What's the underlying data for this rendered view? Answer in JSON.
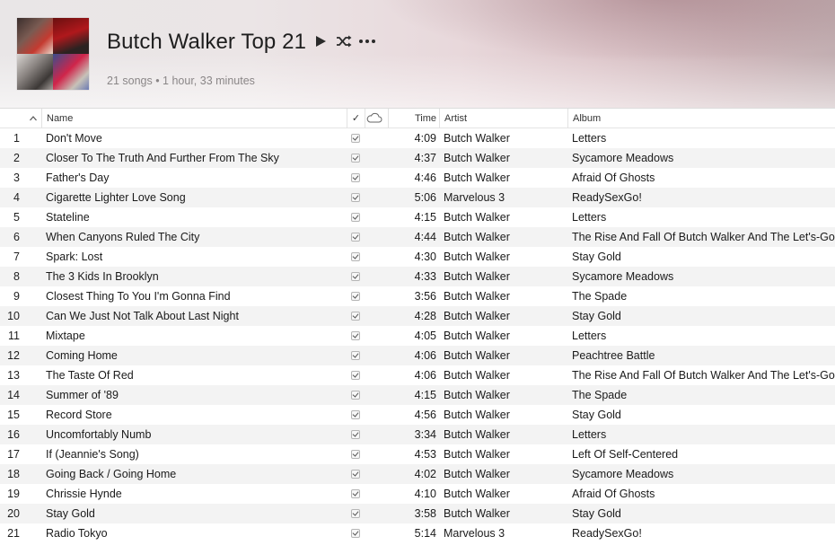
{
  "playlist": {
    "title": "Butch Walker Top 21",
    "meta": "21 songs • 1 hour, 33 minutes"
  },
  "controls": {
    "play_icon": "play-icon",
    "shuffle_icon": "shuffle-icon",
    "more_icon": "more-icon"
  },
  "columns": {
    "name": "Name",
    "check": "✓",
    "cloud_icon": "cloud-icon",
    "time": "Time",
    "artist": "Artist",
    "album": "Album"
  },
  "tracks": [
    {
      "num": "1",
      "name": "Don't Move",
      "time": "4:09",
      "artist": "Butch Walker",
      "album": "Letters"
    },
    {
      "num": "2",
      "name": "Closer To The Truth And Further From The Sky",
      "time": "4:37",
      "artist": "Butch Walker",
      "album": "Sycamore Meadows"
    },
    {
      "num": "3",
      "name": "Father's Day",
      "time": "4:46",
      "artist": "Butch Walker",
      "album": "Afraid Of Ghosts"
    },
    {
      "num": "4",
      "name": "Cigarette Lighter Love Song",
      "time": "5:06",
      "artist": "Marvelous 3",
      "album": "ReadySexGo!"
    },
    {
      "num": "5",
      "name": "Stateline",
      "time": "4:15",
      "artist": "Butch Walker",
      "album": "Letters"
    },
    {
      "num": "6",
      "name": "When Canyons Ruled The City",
      "time": "4:44",
      "artist": "Butch Walker",
      "album": "The Rise And Fall Of Butch Walker And The Let's-Go-Out-Tonites"
    },
    {
      "num": "7",
      "name": "Spark: Lost",
      "time": "4:30",
      "artist": "Butch Walker",
      "album": "Stay Gold"
    },
    {
      "num": "8",
      "name": "The 3 Kids In Brooklyn",
      "time": "4:33",
      "artist": "Butch Walker",
      "album": "Sycamore Meadows"
    },
    {
      "num": "9",
      "name": "Closest Thing To You I'm Gonna Find",
      "time": "3:56",
      "artist": "Butch Walker",
      "album": "The Spade"
    },
    {
      "num": "10",
      "name": "Can We Just Not Talk About Last Night",
      "time": "4:28",
      "artist": "Butch Walker",
      "album": "Stay Gold"
    },
    {
      "num": "11",
      "name": "Mixtape",
      "time": "4:05",
      "artist": "Butch Walker",
      "album": "Letters"
    },
    {
      "num": "12",
      "name": "Coming Home",
      "time": "4:06",
      "artist": "Butch Walker",
      "album": "Peachtree Battle"
    },
    {
      "num": "13",
      "name": "The Taste Of Red",
      "time": "4:06",
      "artist": "Butch Walker",
      "album": "The Rise And Fall Of Butch Walker And The Let's-Go-Out-Tonites"
    },
    {
      "num": "14",
      "name": "Summer of '89",
      "time": "4:15",
      "artist": "Butch Walker",
      "album": "The Spade"
    },
    {
      "num": "15",
      "name": "Record Store",
      "time": "4:56",
      "artist": "Butch Walker",
      "album": "Stay Gold"
    },
    {
      "num": "16",
      "name": "Uncomfortably Numb",
      "time": "3:34",
      "artist": "Butch Walker",
      "album": "Letters"
    },
    {
      "num": "17",
      "name": "If (Jeannie's Song)",
      "time": "4:53",
      "artist": "Butch Walker",
      "album": "Left Of Self-Centered"
    },
    {
      "num": "18",
      "name": "Going Back / Going Home",
      "time": "4:02",
      "artist": "Butch Walker",
      "album": "Sycamore Meadows"
    },
    {
      "num": "19",
      "name": "Chrissie Hynde",
      "time": "4:10",
      "artist": "Butch Walker",
      "album": "Afraid Of Ghosts"
    },
    {
      "num": "20",
      "name": "Stay Gold",
      "time": "3:58",
      "artist": "Butch Walker",
      "album": "Stay Gold"
    },
    {
      "num": "21",
      "name": "Radio Tokyo",
      "time": "5:14",
      "artist": "Marvelous 3",
      "album": "ReadySexGo!"
    }
  ]
}
